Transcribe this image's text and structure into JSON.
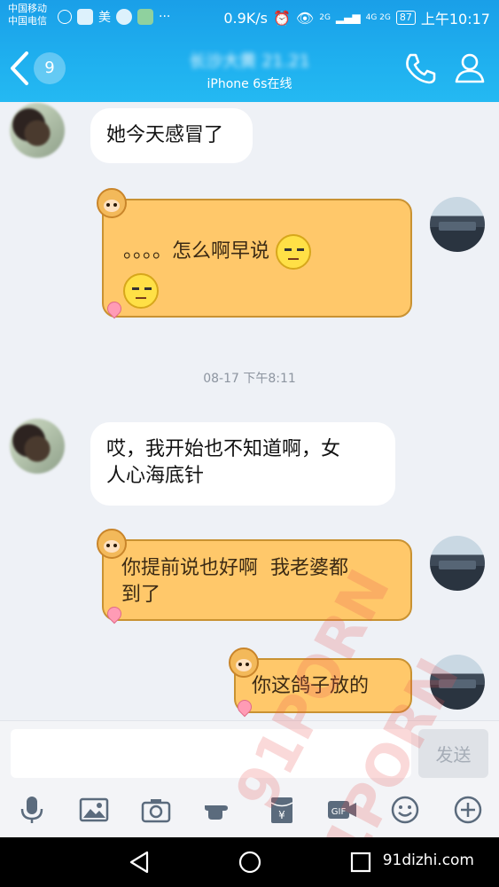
{
  "status_bar": {
    "carrier_1": "中国移动",
    "carrier_2": "中国电信",
    "app_label": "美",
    "dots": "···",
    "net_speed": "0.9K/s",
    "network_1": "2G",
    "network_2": "4G 2G",
    "battery": "87",
    "time": "上午10:17"
  },
  "header": {
    "unread_count": "9",
    "title": "长沙大黄 21.21",
    "subtitle": "iPhone 6s在线"
  },
  "messages": [
    {
      "side": "left",
      "text": "她今天感冒了"
    },
    {
      "side": "right",
      "text": "。。。。怎么啊早说",
      "emojis": [
        "doubt-face",
        "doubt-face"
      ]
    },
    {
      "side": "left",
      "text": "哎，我开始也不知道啊，女\n人心海底针"
    },
    {
      "side": "right",
      "text": "你提前说也好啊  我老婆都\n到了"
    },
    {
      "side": "right",
      "text": "你这鸽子放的"
    }
  ],
  "timestamp": "08-17 下午8:11",
  "input": {
    "placeholder": "",
    "value": "",
    "send_label": "发送"
  },
  "toolbar": [
    "mic-icon",
    "image-icon",
    "camera-icon",
    "hand-icon",
    "red-packet-icon",
    "gif-icon",
    "emoji-icon",
    "plus-icon"
  ],
  "watermarks": [
    "91PORN",
    "91PORN"
  ],
  "watermark_url": "91dizhi.com",
  "colors": {
    "header_blue": "#1fb0ef",
    "bubble_orange": "#ffc86a",
    "bubble_white": "#ffffff",
    "background": "#eef1f6"
  }
}
